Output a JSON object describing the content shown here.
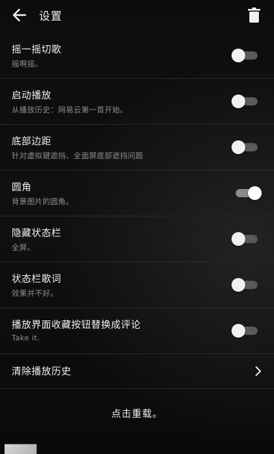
{
  "header": {
    "title": "设置",
    "back_icon": "arrow-left-icon",
    "trash_icon": "trash-icon"
  },
  "settings": [
    {
      "label": "摇一摇切歌",
      "desc": "摇啊摇。",
      "enabled": false
    },
    {
      "label": "启动播放",
      "desc": "从播放历史：网易云第一首开始。",
      "enabled": false
    },
    {
      "label": "底部边距",
      "desc": "针对虚拟键遮挡、全面屏底部遮挡问题",
      "enabled": false
    },
    {
      "label": "圆角",
      "desc": "背景图片的圆角。",
      "enabled": true
    },
    {
      "label": "隐藏状态栏",
      "desc": "全屏。",
      "enabled": false
    },
    {
      "label": "状态栏歌词",
      "desc": "效果并不好。",
      "enabled": false
    },
    {
      "label": "播放界面收藏按钮替换成评论",
      "desc": "Take it.",
      "enabled": false
    }
  ],
  "clear_history": {
    "label": "清除播放历史",
    "icon": "chevron-right-icon"
  },
  "reload_label": "点击重载。",
  "colors": {
    "background": "#0b0b0b",
    "divider": "#2a2a2a",
    "thumb": "#f1f1f1",
    "track_off": "#5a5a5a",
    "track_on": "#8b8b8b"
  }
}
